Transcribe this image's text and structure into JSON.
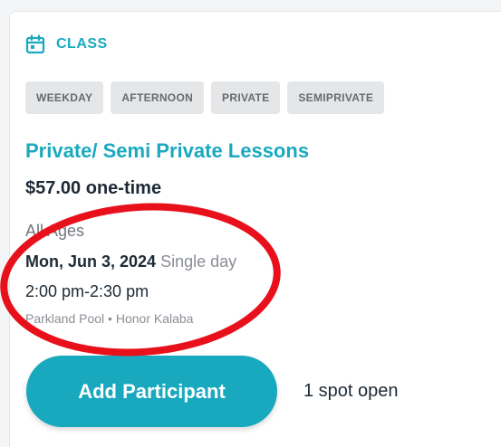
{
  "listing": {
    "type_label": "CLASS",
    "tags": [
      "WEEKDAY",
      "AFTERNOON",
      "PRIVATE",
      "SEMIPRIVATE"
    ],
    "title": "Private/ Semi Private Lessons",
    "price": "$57.00 one-time",
    "ages": "All Ages",
    "date": "Mon, Jun 3, 2024",
    "frequency": "Single day",
    "time": "2:00 pm-2:30 pm",
    "location": "Parkland Pool • Honor Kalaba",
    "add_button_label": "Add Participant",
    "spots_text": "1 spot open"
  },
  "colors": {
    "accent": "#1aa9bf",
    "annotation": "#e8101a"
  },
  "icons": {
    "type_icon": "calendar-icon"
  }
}
